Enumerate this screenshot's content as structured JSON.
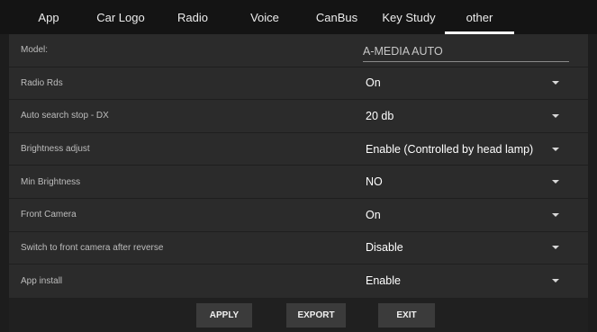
{
  "tabs": [
    {
      "label": "App"
    },
    {
      "label": "Car Logo"
    },
    {
      "label": "Radio"
    },
    {
      "label": "Voice"
    },
    {
      "label": "CanBus"
    },
    {
      "label": "Key Study"
    },
    {
      "label": "other",
      "active": true
    }
  ],
  "settings": {
    "model": {
      "label": "Model:",
      "value": "A-MEDIA AUTO"
    },
    "radio_rds": {
      "label": "Radio Rds",
      "value": "On"
    },
    "auto_search": {
      "label": "Auto search stop - DX",
      "value": "20 db"
    },
    "brightness_adjust": {
      "label": "Brightness adjust",
      "value": "Enable (Controlled by head lamp)"
    },
    "min_brightness": {
      "label": "Min Brightness",
      "value": "NO"
    },
    "front_camera": {
      "label": "Front Camera",
      "value": "On"
    },
    "switch_front_camera": {
      "label": "Switch to front camera after reverse",
      "value": "Disable"
    },
    "app_install": {
      "label": "App install",
      "value": "Enable"
    }
  },
  "footer": {
    "apply_label": "APPLY",
    "export_label": "EXPORT",
    "exit_label": "EXIT"
  },
  "colors": {
    "background": "#1d1d1d",
    "panel": "#2b2b2b",
    "tab_bar": "#141414",
    "active_indicator": "#ffffff",
    "button": "#3b3b3b"
  }
}
